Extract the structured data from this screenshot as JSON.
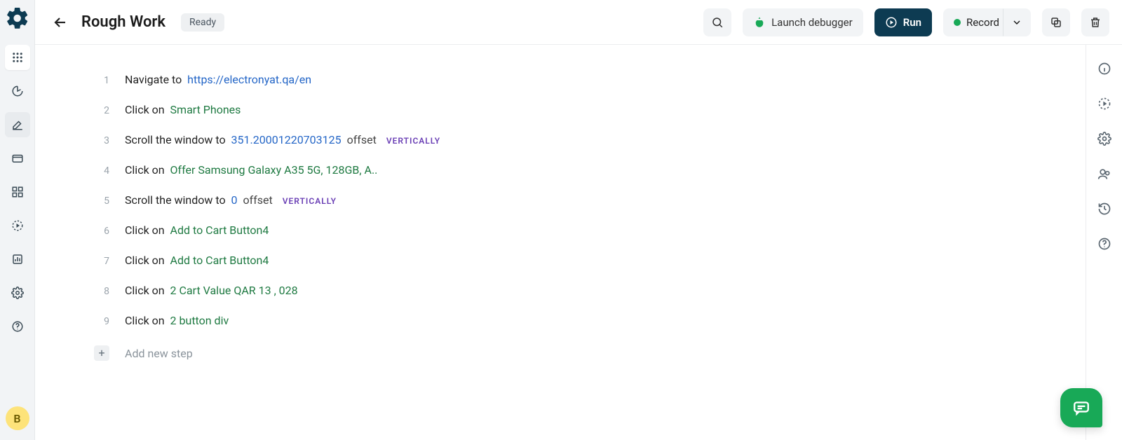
{
  "header": {
    "title": "Rough Work",
    "status": "Ready",
    "launch_debugger": "Launch debugger",
    "run": "Run",
    "record": "Record"
  },
  "sidebar": {
    "avatar_initial": "B"
  },
  "labels": {
    "navigate_to": "Navigate to",
    "click_on": "Click on",
    "scroll_to": "Scroll the window to",
    "offset": "offset",
    "vertically": "VERTICALLY",
    "add_new_step": "Add new step"
  },
  "steps": [
    {
      "n": "1",
      "type": "navigate",
      "url": "https://electronyat.qa/en"
    },
    {
      "n": "2",
      "type": "click",
      "target": "Smart Phones"
    },
    {
      "n": "3",
      "type": "scroll",
      "value": "351.20001220703125"
    },
    {
      "n": "4",
      "type": "click",
      "target": "Offer Samsung Galaxy A35 5G, 128GB, A.."
    },
    {
      "n": "5",
      "type": "scroll",
      "value": "0"
    },
    {
      "n": "6",
      "type": "click",
      "target": "Add to Cart Button4"
    },
    {
      "n": "7",
      "type": "click",
      "target": "Add to Cart Button4"
    },
    {
      "n": "8",
      "type": "click",
      "target": "2 Cart Value QAR 13 , 028"
    },
    {
      "n": "9",
      "type": "click",
      "target": "2 button div"
    }
  ]
}
